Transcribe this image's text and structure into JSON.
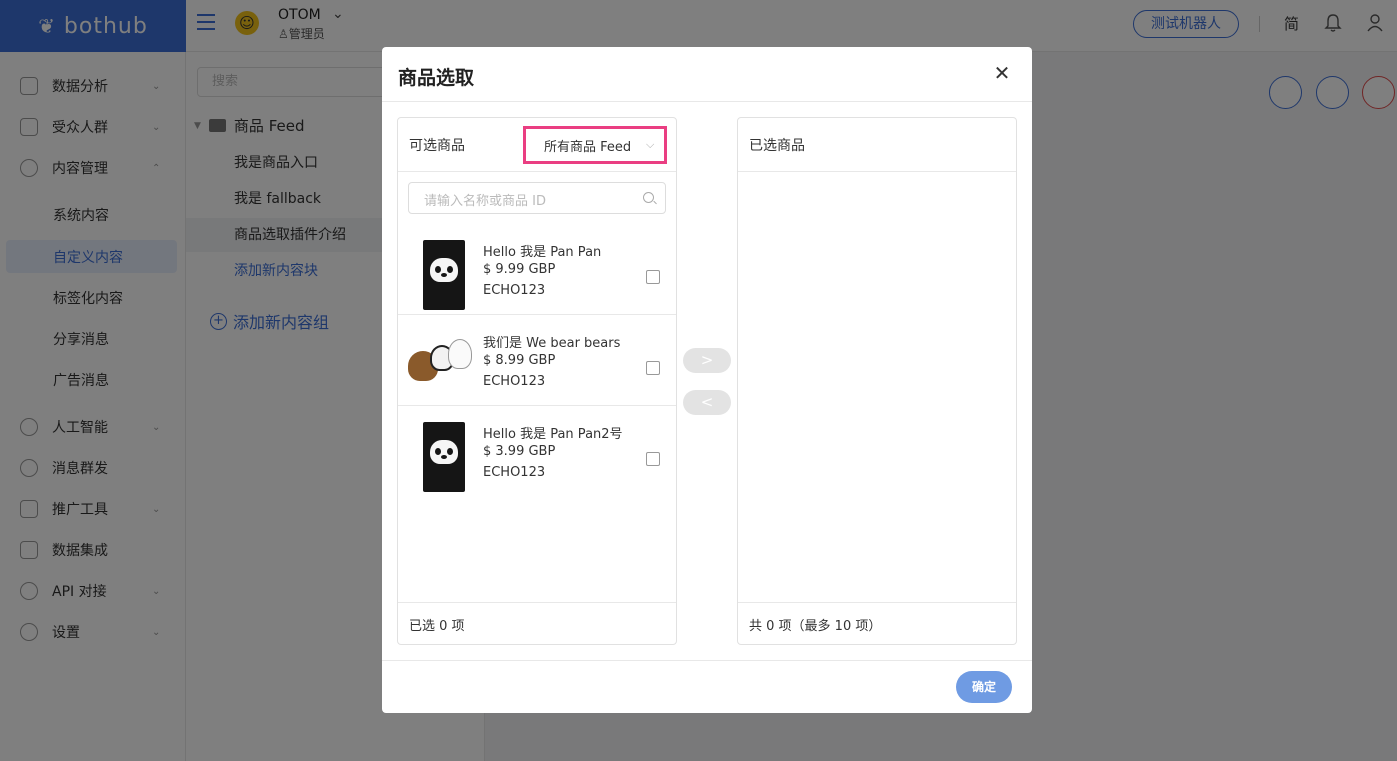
{
  "app": {
    "logo_text": "bothub",
    "account_name": "OTOM",
    "account_role": "管理员",
    "test_bot_label": "测试机器人",
    "lang_label": "简"
  },
  "sidebar": {
    "items": [
      {
        "label": "数据分析",
        "icon": "chart-icon"
      },
      {
        "label": "受众人群",
        "icon": "users-icon"
      },
      {
        "label": "内容管理",
        "icon": "chat-icon"
      },
      {
        "label": "系统内容"
      },
      {
        "label": "自定义内容",
        "active": true
      },
      {
        "label": "标签化内容"
      },
      {
        "label": "分享消息"
      },
      {
        "label": "广告消息"
      },
      {
        "label": "人工智能",
        "icon": "brain-icon"
      },
      {
        "label": "消息群发",
        "icon": "clock-icon"
      },
      {
        "label": "推广工具",
        "icon": "promo-icon"
      },
      {
        "label": "数据集成",
        "icon": "grid-icon"
      },
      {
        "label": "API 对接",
        "icon": "link-icon"
      },
      {
        "label": "设置",
        "icon": "gear-icon"
      }
    ]
  },
  "tree": {
    "search_placeholder": "搜索",
    "folder_label": "商品 Feed",
    "leaves": [
      "我是商品入口",
      "我是 fallback",
      "商品选取插件介绍"
    ],
    "add_block_label": "添加新内容块",
    "add_group_label": "添加新内容组"
  },
  "modal": {
    "title": "商品选取",
    "left_panel": {
      "title": "可选商品",
      "feed_select_value": "所有商品 Feed",
      "search_placeholder": "请输入名称或商品 ID",
      "footer": "已选 0 项"
    },
    "products": [
      {
        "name": "Hello 我是 Pan Pan",
        "price": "$ 9.99 GBP",
        "code": "ECHO123",
        "thumb": "panda"
      },
      {
        "name": "我们是 We bear bears",
        "price": "$ 8.99 GBP",
        "code": "ECHO123",
        "thumb": "bears"
      },
      {
        "name": "Hello 我是 Pan Pan2号",
        "price": "$ 3.99 GBP",
        "code": "ECHO123",
        "thumb": "panda"
      }
    ],
    "right_panel": {
      "title": "已选商品",
      "footer": "共 0 项（最多 10 项）"
    },
    "move_right_label": ">",
    "move_left_label": "<",
    "confirm_label": "确定"
  },
  "colors": {
    "brand": "#3d6fd6",
    "highlight": "#ea3e82",
    "confirm": "#6f9be3",
    "danger": "#e04b4b"
  }
}
